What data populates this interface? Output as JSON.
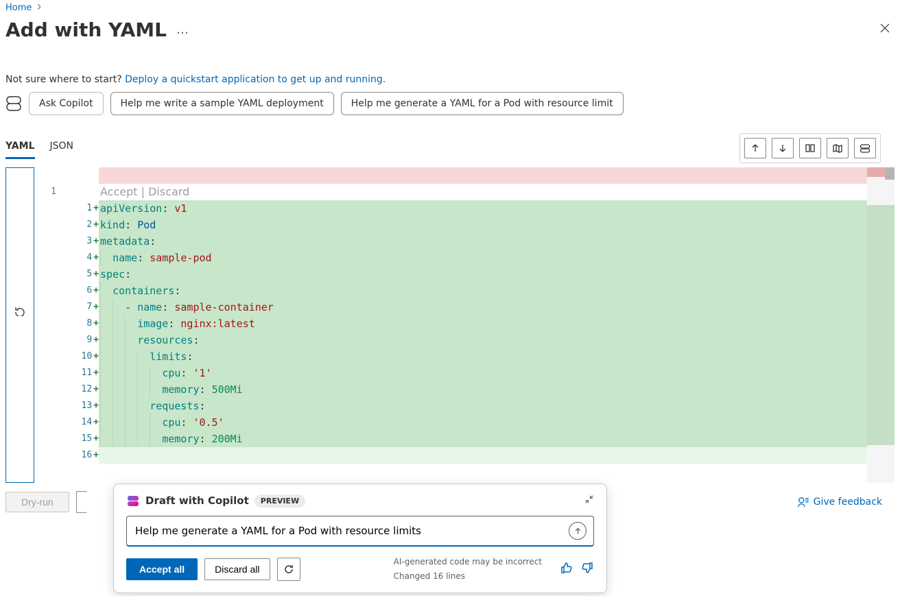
{
  "breadcrumb": {
    "home": "Home"
  },
  "title": "Add with YAML",
  "more": "…",
  "help": {
    "lead": "Not sure where to start?  ",
    "link": "Deploy a quickstart application to get up and running."
  },
  "suggestions": {
    "ask": "Ask Copilot",
    "s1": "Help me write a sample YAML deployment",
    "s2": "Help me generate a YAML for a Pod with resource limit"
  },
  "tabs": {
    "yaml": "YAML",
    "json": "JSON"
  },
  "editor": {
    "orig_line_no": "1",
    "accept": "Accept",
    "discard": "Discard",
    "lines": [
      {
        "n": "1",
        "tokens": [
          [
            "k",
            "apiVersion"
          ],
          [
            "p",
            ": "
          ],
          [
            "s",
            "v1"
          ]
        ]
      },
      {
        "n": "2",
        "tokens": [
          [
            "k",
            "kind"
          ],
          [
            "p",
            ": "
          ],
          [
            "v",
            "Pod"
          ]
        ]
      },
      {
        "n": "3",
        "tokens": [
          [
            "k",
            "metadata"
          ],
          [
            "p",
            ":"
          ]
        ]
      },
      {
        "n": "4",
        "indent": 1,
        "tokens": [
          [
            "k",
            "name"
          ],
          [
            "p",
            ": "
          ],
          [
            "s",
            "sample-pod"
          ]
        ]
      },
      {
        "n": "5",
        "tokens": [
          [
            "k",
            "spec"
          ],
          [
            "p",
            ":"
          ]
        ]
      },
      {
        "n": "6",
        "indent": 1,
        "tokens": [
          [
            "k",
            "containers"
          ],
          [
            "p",
            ":"
          ]
        ]
      },
      {
        "n": "7",
        "indent": 2,
        "prefix": "- ",
        "tokens": [
          [
            "k",
            "name"
          ],
          [
            "p",
            ": "
          ],
          [
            "s",
            "sample-container"
          ]
        ]
      },
      {
        "n": "8",
        "indent": 3,
        "tokens": [
          [
            "k",
            "image"
          ],
          [
            "p",
            ": "
          ],
          [
            "s",
            "nginx:latest"
          ]
        ]
      },
      {
        "n": "9",
        "indent": 3,
        "tokens": [
          [
            "k",
            "resources"
          ],
          [
            "p",
            ":"
          ]
        ]
      },
      {
        "n": "10",
        "indent": 4,
        "tokens": [
          [
            "k",
            "limits"
          ],
          [
            "p",
            ":"
          ]
        ]
      },
      {
        "n": "11",
        "indent": 5,
        "tokens": [
          [
            "k",
            "cpu"
          ],
          [
            "p",
            ": "
          ],
          [
            "s",
            "'1'"
          ]
        ]
      },
      {
        "n": "12",
        "indent": 5,
        "tokens": [
          [
            "k",
            "memory"
          ],
          [
            "p",
            ": "
          ],
          [
            "n",
            "500Mi"
          ]
        ]
      },
      {
        "n": "13",
        "indent": 4,
        "tokens": [
          [
            "k",
            "requests"
          ],
          [
            "p",
            ":"
          ]
        ]
      },
      {
        "n": "14",
        "indent": 5,
        "tokens": [
          [
            "k",
            "cpu"
          ],
          [
            "p",
            ": "
          ],
          [
            "s",
            "'0.5'"
          ]
        ]
      },
      {
        "n": "15",
        "indent": 5,
        "tokens": [
          [
            "k",
            "memory"
          ],
          [
            "p",
            ": "
          ],
          [
            "n",
            "200Mi"
          ]
        ]
      }
    ],
    "trailing_line_no": "16"
  },
  "copilot_card": {
    "title": "Draft with Copilot",
    "badge": "PREVIEW",
    "input_value": "Help me generate a YAML for a Pod with resource limits",
    "accept_all": "Accept all",
    "discard_all": "Discard all",
    "note1": "AI-generated code may be incorrect",
    "note2": "Changed 16 lines"
  },
  "footer": {
    "dry_run": "Dry-run",
    "feedback": "Give feedback"
  }
}
